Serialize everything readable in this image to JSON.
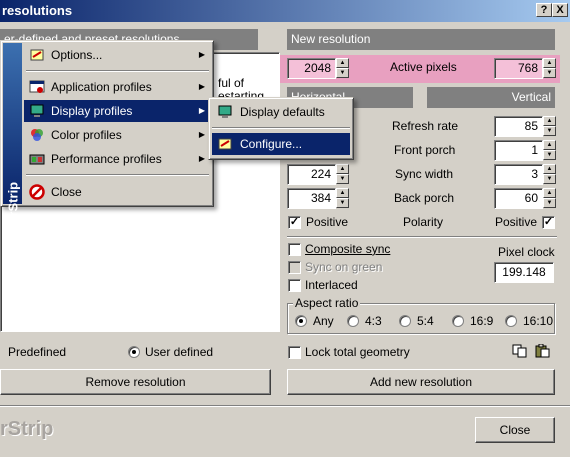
{
  "window": {
    "title": "resolutions",
    "help_btn": "?",
    "close_btn": "X"
  },
  "left_panel": {
    "header_text": "er-defined and preset resolutions",
    "partial_text_1": "ful of",
    "partial_text_2": "estarting",
    "radio_predefined": "Predefined",
    "radio_user_defined": "User defined",
    "remove_button": "Remove resolution"
  },
  "right_panel": {
    "header": "New resolution",
    "active_pixels_label": "Active pixels",
    "active_w": "2048",
    "active_h": "768",
    "horizontal_tab": "Horizontal",
    "vertical_tab": "Vertical",
    "rows": [
      {
        "label": "Refresh rate",
        "h": "",
        "v": "85"
      },
      {
        "label": "Front porch",
        "h": "",
        "v": "1"
      },
      {
        "label": "Sync width",
        "h": "224",
        "v": "3"
      },
      {
        "label": "Back porch",
        "h": "384",
        "v": "60"
      }
    ],
    "polarity_label": "Polarity",
    "pos_h": "Positive",
    "pos_v": "Positive",
    "composite_sync": "Composite sync",
    "sync_on_green": "Sync on green",
    "interlaced": "Interlaced",
    "pixel_clock_label": "Pixel clock",
    "pixel_clock_value": "199.148",
    "aspect_ratio_label": "Aspect ratio",
    "aspect_options": [
      "Any",
      "4:3",
      "5:4",
      "16:9",
      "16:10"
    ],
    "lock_geometry": "Lock total geometry",
    "add_button": "Add new resolution"
  },
  "footer": {
    "brand": "rStrip",
    "close_button": "Close"
  },
  "context_menu": {
    "side_label": "PowerStrip",
    "items": [
      "Options...",
      "Application profiles",
      "Display profiles",
      "Color profiles",
      "Performance profiles",
      "Close"
    ]
  },
  "submenu": {
    "items": [
      "Display defaults",
      "Configure..."
    ]
  },
  "colors": {
    "highlight": "#e8a0c0",
    "selection": "#0a246a",
    "face": "#d4d0c8"
  }
}
